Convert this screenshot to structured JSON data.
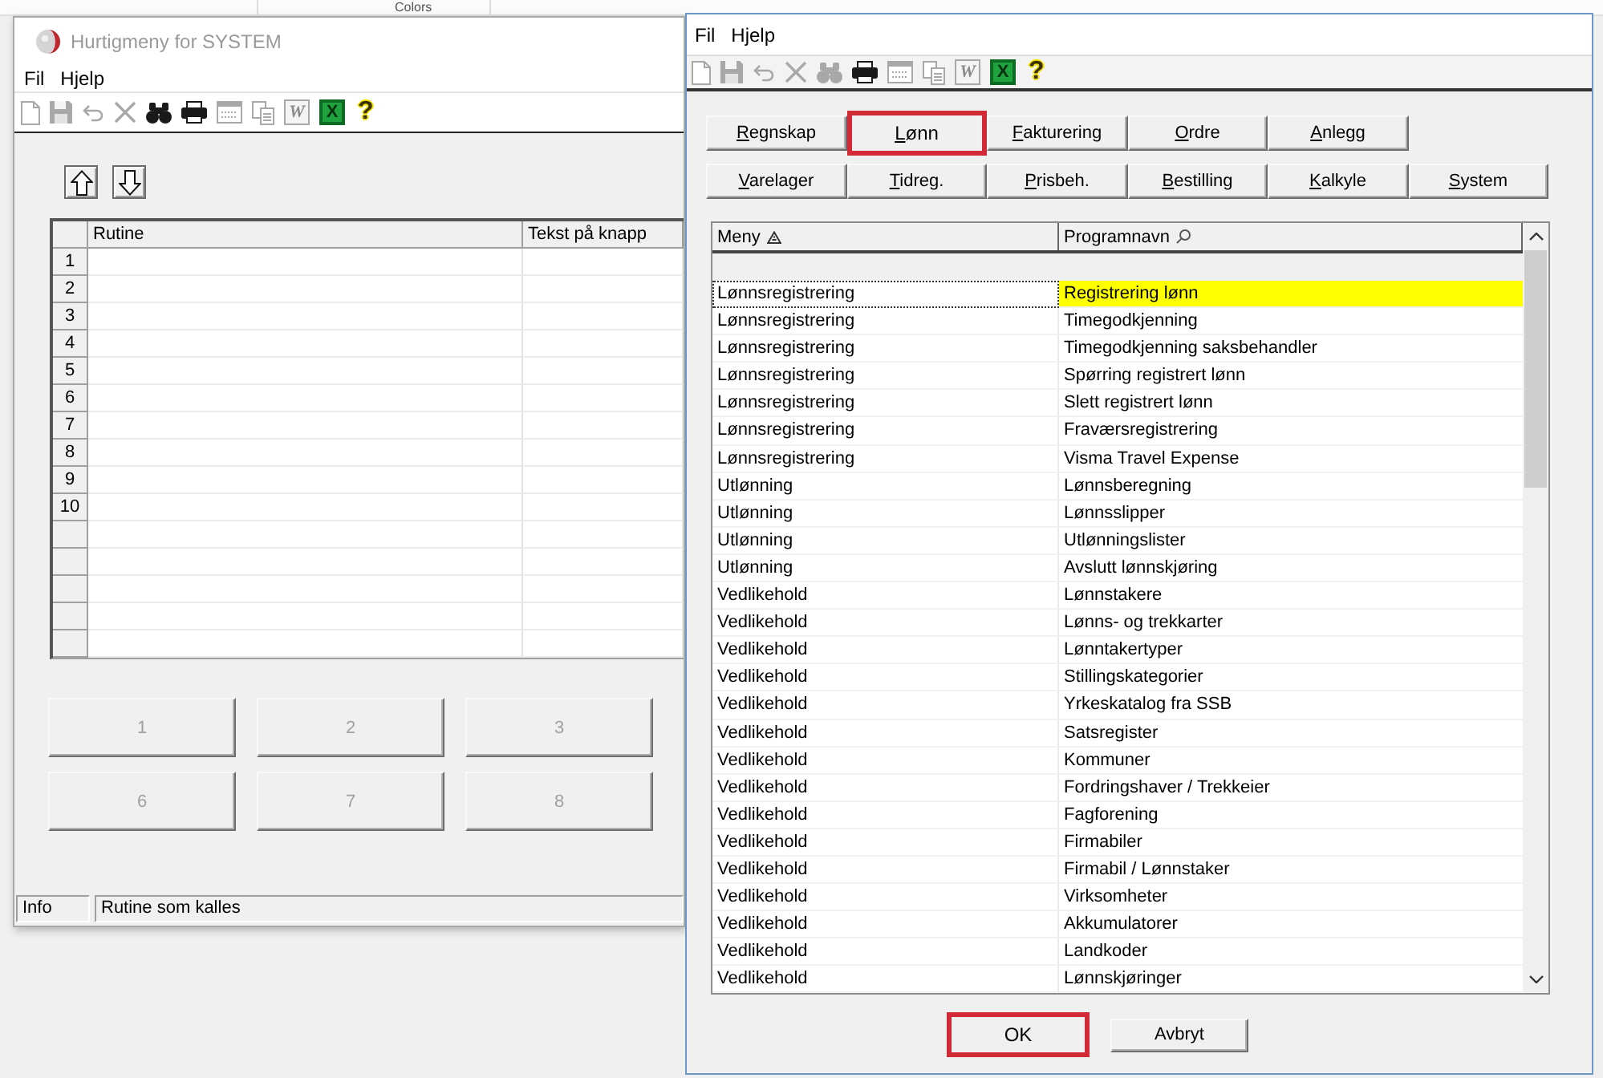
{
  "background_window": {
    "label": "Colors"
  },
  "left_window": {
    "title": "Hurtigmeny for SYSTEM",
    "active": false,
    "menu": [
      "Fil",
      "Hjelp"
    ],
    "toolbar": [
      {
        "kind": "new",
        "disabled": true
      },
      {
        "kind": "save",
        "disabled": true
      },
      {
        "kind": "undo",
        "disabled": true
      },
      {
        "kind": "delete",
        "disabled": true
      },
      {
        "kind": "find",
        "disabled": false
      },
      {
        "kind": "print",
        "disabled": false
      },
      {
        "kind": "form",
        "disabled": true
      },
      {
        "kind": "copy",
        "disabled": true
      },
      {
        "kind": "word",
        "glyph": "W",
        "disabled": true
      },
      {
        "kind": "excel",
        "glyph": "X",
        "disabled": false
      },
      {
        "kind": "help",
        "glyph": "?",
        "disabled": false
      }
    ],
    "move_buttons": [
      {
        "kind": "up"
      },
      {
        "kind": "down"
      }
    ],
    "grid": {
      "columns": [
        "Rutine",
        "Tekst på knapp"
      ],
      "rows": [
        {
          "number": "1"
        },
        {
          "number": "2"
        },
        {
          "number": "3"
        },
        {
          "number": "4"
        },
        {
          "number": "5"
        },
        {
          "number": "6"
        },
        {
          "number": "7"
        },
        {
          "number": "8"
        },
        {
          "number": "9"
        },
        {
          "number": "10"
        },
        {},
        {},
        {},
        {},
        {}
      ]
    },
    "quick_buttons": [
      {
        "label": "1",
        "disabled": true
      },
      {
        "label": "2",
        "disabled": true
      },
      {
        "label": "3",
        "disabled": true
      },
      {
        "label": "6",
        "disabled": true
      },
      {
        "label": "7",
        "disabled": true
      },
      {
        "label": "8",
        "disabled": true
      }
    ],
    "status_bar": {
      "label": "Info",
      "text": "Rutine som kalles"
    }
  },
  "right_window": {
    "menu": [
      "Fil",
      "Hjelp"
    ],
    "toolbar": [
      {
        "kind": "new",
        "disabled": true
      },
      {
        "kind": "save",
        "disabled": true
      },
      {
        "kind": "undo",
        "disabled": true
      },
      {
        "kind": "delete",
        "disabled": true
      },
      {
        "kind": "find",
        "disabled": true
      },
      {
        "kind": "print",
        "disabled": false
      },
      {
        "kind": "form",
        "disabled": true
      },
      {
        "kind": "copy",
        "disabled": true
      },
      {
        "kind": "word",
        "glyph": "W",
        "disabled": true
      },
      {
        "kind": "excel",
        "glyph": "X",
        "disabled": false
      },
      {
        "kind": "help",
        "glyph": "?",
        "disabled": false
      }
    ],
    "module_rows": [
      [
        {
          "label": "Regnskap",
          "selected": false
        },
        {
          "label": "Lønn",
          "selected": true
        },
        {
          "label": "Fakturering",
          "selected": false
        },
        {
          "label": "Ordre",
          "selected": false
        },
        {
          "label": "Anlegg",
          "selected": false
        }
      ],
      [
        {
          "label": "Varelager",
          "selected": false
        },
        {
          "label": "Tidreg.",
          "selected": false
        },
        {
          "label": "Prisbeh.",
          "selected": false
        },
        {
          "label": "Bestilling",
          "selected": false
        },
        {
          "label": "Kalkyle",
          "selected": false
        },
        {
          "label": "System",
          "selected": false
        }
      ]
    ],
    "list": {
      "columns": [
        {
          "label": "Meny",
          "kind": "sorted"
        },
        {
          "label": "Programnavn",
          "kind": "searchable"
        }
      ],
      "rows": [
        {
          "meny": "Lønnsregistrering",
          "program": "Registrering lønn",
          "selected": true
        },
        {
          "meny": "Lønnsregistrering",
          "program": "Timegodkjenning",
          "selected": false
        },
        {
          "meny": "Lønnsregistrering",
          "program": "Timegodkjenning saksbehandler",
          "selected": false
        },
        {
          "meny": "Lønnsregistrering",
          "program": "Spørring registrert lønn",
          "selected": false
        },
        {
          "meny": "Lønnsregistrering",
          "program": "Slett registrert lønn",
          "selected": false
        },
        {
          "meny": "Lønnsregistrering",
          "program": "Fraværsregistrering",
          "selected": false
        },
        {
          "meny": "Lønnsregistrering",
          "program": "Visma Travel Expense",
          "selected": false
        },
        {
          "meny": "Utlønning",
          "program": "Lønnsberegning",
          "selected": false
        },
        {
          "meny": "Utlønning",
          "program": "Lønnsslipper",
          "selected": false
        },
        {
          "meny": "Utlønning",
          "program": "Utlønningslister",
          "selected": false
        },
        {
          "meny": "Utlønning",
          "program": "Avslutt lønnskjøring",
          "selected": false
        },
        {
          "meny": "Vedlikehold",
          "program": "Lønnstakere",
          "selected": false
        },
        {
          "meny": "Vedlikehold",
          "program": "Lønns- og trekkarter",
          "selected": false
        },
        {
          "meny": "Vedlikehold",
          "program": "Lønntakertyper",
          "selected": false
        },
        {
          "meny": "Vedlikehold",
          "program": "Stillingskategorier",
          "selected": false
        },
        {
          "meny": "Vedlikehold",
          "program": "Yrkeskatalog fra SSB",
          "selected": false
        },
        {
          "meny": "Vedlikehold",
          "program": "Satsregister",
          "selected": false
        },
        {
          "meny": "Vedlikehold",
          "program": "Kommuner",
          "selected": false
        },
        {
          "meny": "Vedlikehold",
          "program": "Fordringshaver / Trekkeier",
          "selected": false
        },
        {
          "meny": "Vedlikehold",
          "program": "Fagforening",
          "selected": false
        },
        {
          "meny": "Vedlikehold",
          "program": "Firmabiler",
          "selected": false
        },
        {
          "meny": "Vedlikehold",
          "program": "Firmabil / Lønnstaker",
          "selected": false
        },
        {
          "meny": "Vedlikehold",
          "program": "Virksomheter",
          "selected": false
        },
        {
          "meny": "Vedlikehold",
          "program": "Akkumulatorer",
          "selected": false
        },
        {
          "meny": "Vedlikehold",
          "program": "Landkoder",
          "selected": false
        },
        {
          "meny": "Vedlikehold",
          "program": "Lønnskjøringer",
          "selected": false
        }
      ]
    },
    "buttons": [
      {
        "label": "OK",
        "highlighted": true
      },
      {
        "label": "Avbryt",
        "highlighted": false
      }
    ]
  }
}
